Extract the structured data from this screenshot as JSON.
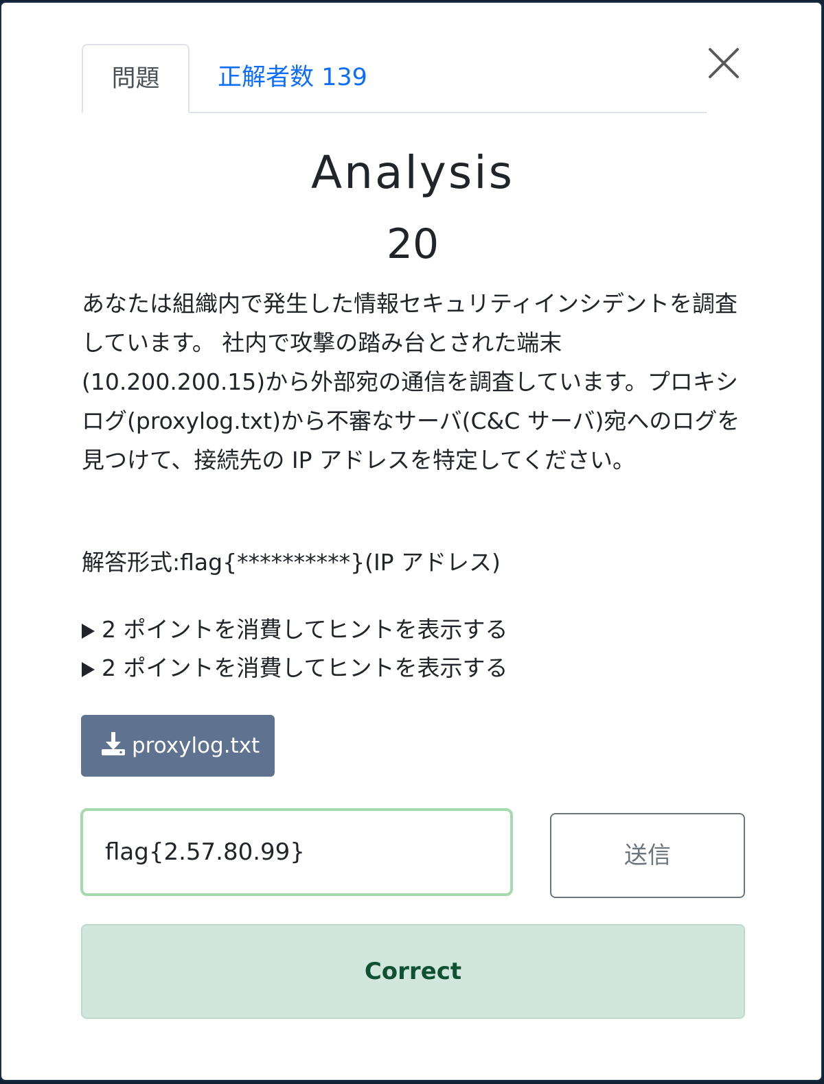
{
  "tabs": {
    "problem_label": "問題",
    "solvers_label": "正解者数 139"
  },
  "challenge": {
    "title": "Analysis",
    "points": "20",
    "description": "あなたは組織内で発生した情報セキュリティインシデントを調査しています。 社内で攻撃の踏み台とされた端末(10.200.200.15)から外部宛の通信を調査しています。プロキシログ(proxylog.txt)から不審なサーバ(C&C サーバ)宛へのログを見つけて、接続先の IP アドレスを特定してください。",
    "answer_format": "解答形式:flag{**********}(IP アドレス)"
  },
  "hints": [
    {
      "label": "2 ポイントを消費してヒントを表示する"
    },
    {
      "label": "2 ポイントを消費してヒントを表示する"
    }
  ],
  "file": {
    "name": "proxylog.txt",
    "icon": "download-icon"
  },
  "form": {
    "flag_value": "flag{2.57.80.99}",
    "submit_label": "送信"
  },
  "result": {
    "message": "Correct"
  },
  "icons": {
    "close": "close-icon"
  },
  "colors": {
    "link": "#0d6efd",
    "download_button": "#5f7290",
    "success_bg": "#d1e7dd",
    "success_text": "#0f5132",
    "input_border": "#a6d9ad"
  }
}
